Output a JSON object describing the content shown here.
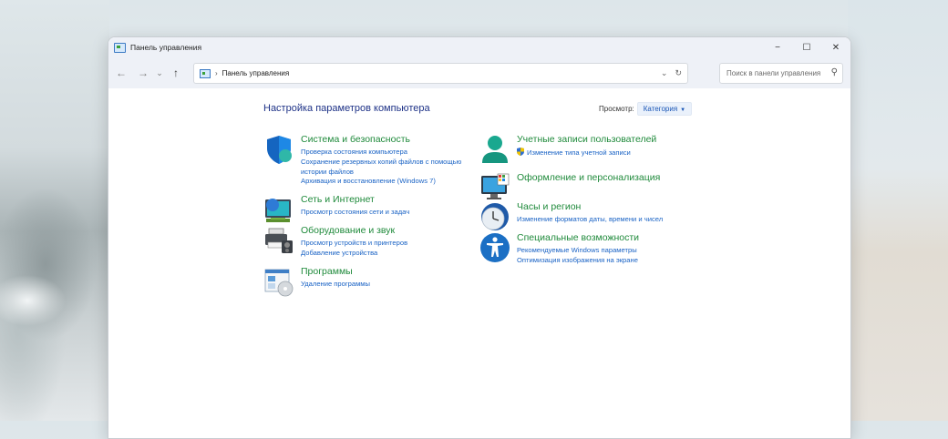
{
  "window": {
    "title": "Панель управления",
    "controls": {
      "minimize": "−",
      "maximize": "☐",
      "close": "✕"
    }
  },
  "navbar": {
    "back": "←",
    "forward": "→",
    "recent": "⌄",
    "up": "↑",
    "address": {
      "separator": "›",
      "path": "Панель управления",
      "dropdown": "⌄",
      "refresh": "↻"
    },
    "search_placeholder": "Поиск в панели управления"
  },
  "main": {
    "heading": "Настройка параметров компьютера",
    "view_label": "Просмотр:",
    "view_value": "Категория",
    "categories": [
      {
        "title": "Система и безопасность",
        "icon": "shield-icon",
        "links": [
          "Проверка состояния компьютера",
          "Сохранение резервных копий файлов с помощью",
          "истории файлов",
          "Архивация и восстановление (Windows 7)"
        ]
      },
      {
        "title": "Сеть и Интернет",
        "icon": "network-icon",
        "links": [
          "Просмотр состояния сети и задач"
        ]
      },
      {
        "title": "Оборудование и звук",
        "icon": "printer-icon",
        "links": [
          "Просмотр устройств и принтеров",
          "Добавление устройства"
        ]
      },
      {
        "title": "Программы",
        "icon": "programs-icon",
        "links": [
          "Удаление программы"
        ]
      },
      {
        "title": "Учетные записи пользователей",
        "icon": "user-icon",
        "links": [
          "Изменение типа учетной записи"
        ]
      },
      {
        "title": "Оформление и персонализация",
        "icon": "monitor-icon",
        "links": []
      },
      {
        "title": "Часы и регион",
        "icon": "clock-icon",
        "links": [
          "Изменение форматов даты, времени и чисел"
        ]
      },
      {
        "title": "Специальные возможности",
        "icon": "accessibility-icon",
        "links": [
          "Рекомендуемые Windows параметры",
          "Оптимизация изображения на экране"
        ]
      }
    ]
  },
  "colors": {
    "heading": "#1e3287",
    "category_title": "#1f8a3b",
    "link": "#1a63c5"
  }
}
